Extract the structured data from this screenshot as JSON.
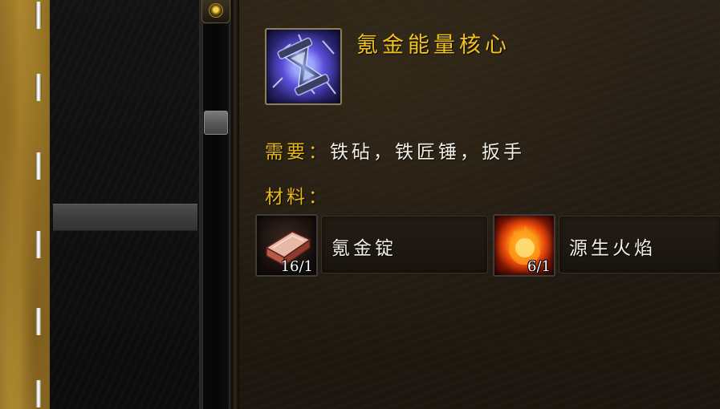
{
  "recipe": {
    "title": "氪金能量核心",
    "icon": "hourglass-energy-icon",
    "requires_label": "需要：",
    "requires_value": "铁砧，铁匠锤，扳手",
    "materials_label": "材料："
  },
  "reagents": [
    {
      "name": "氪金锭",
      "count": "16/1",
      "icon": "ingot-icon"
    },
    {
      "name": "源生火焰",
      "count": "6/1",
      "icon": "fire-orb-icon"
    }
  ],
  "colors": {
    "title": "#f0c21f",
    "label": "#e9b718",
    "text": "#f2efe6"
  }
}
